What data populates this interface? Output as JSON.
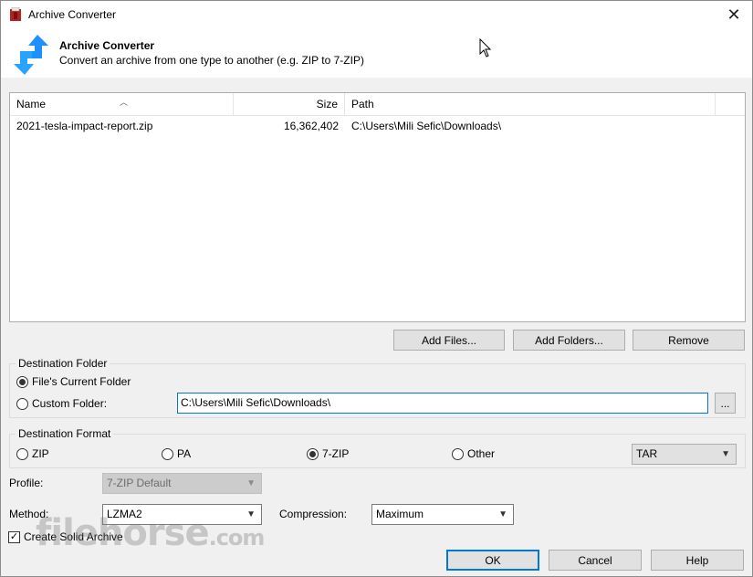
{
  "window": {
    "title": "Archive Converter",
    "close_glyph": "✕"
  },
  "header": {
    "title": "Archive Converter",
    "subtitle": "Convert an archive from one type to another (e.g. ZIP to 7-ZIP)"
  },
  "filelist": {
    "columns": {
      "name": "Name",
      "size": "Size",
      "path": "Path"
    },
    "rows": [
      {
        "name": "2021-tesla-impact-report.zip",
        "size": "16,362,402",
        "path": "C:\\Users\\Mili Sefic\\Downloads\\"
      }
    ]
  },
  "list_buttons": {
    "add_files": "Add Files...",
    "add_folders": "Add Folders...",
    "remove": "Remove"
  },
  "destination_folder": {
    "label": "Destination Folder",
    "current_folder": "File's Current Folder",
    "custom_folder": "Custom Folder:",
    "custom_path": "C:\\Users\\Mili Sefic\\Downloads\\",
    "browse": "...",
    "selected": "current"
  },
  "destination_format": {
    "label": "Destination Format",
    "options": [
      "ZIP",
      "PA",
      "7-ZIP",
      "Other"
    ],
    "selected": "7-ZIP",
    "other_value": "TAR"
  },
  "profile": {
    "label": "Profile:",
    "value": "7-ZIP Default"
  },
  "method": {
    "label": "Method:",
    "value": "LZMA2"
  },
  "compression": {
    "label": "Compression:",
    "value": "Maximum"
  },
  "solid_archive": {
    "label": "Create Solid Archive",
    "checked": true
  },
  "dialog_buttons": {
    "ok": "OK",
    "cancel": "Cancel",
    "help": "Help"
  },
  "watermark": {
    "text": "filehorse",
    "suffix": ".com"
  },
  "icons": {
    "app": "archive-converter-icon",
    "header": "convert-arrows-icon",
    "close": "close-icon",
    "sort": "sort-ascending-icon",
    "dropdown": "chevron-down-icon",
    "check": "check-icon"
  },
  "colors": {
    "accent": "#0078d7",
    "icon_blue": "#1e90ff",
    "disabled_bg": "#cccccc"
  }
}
